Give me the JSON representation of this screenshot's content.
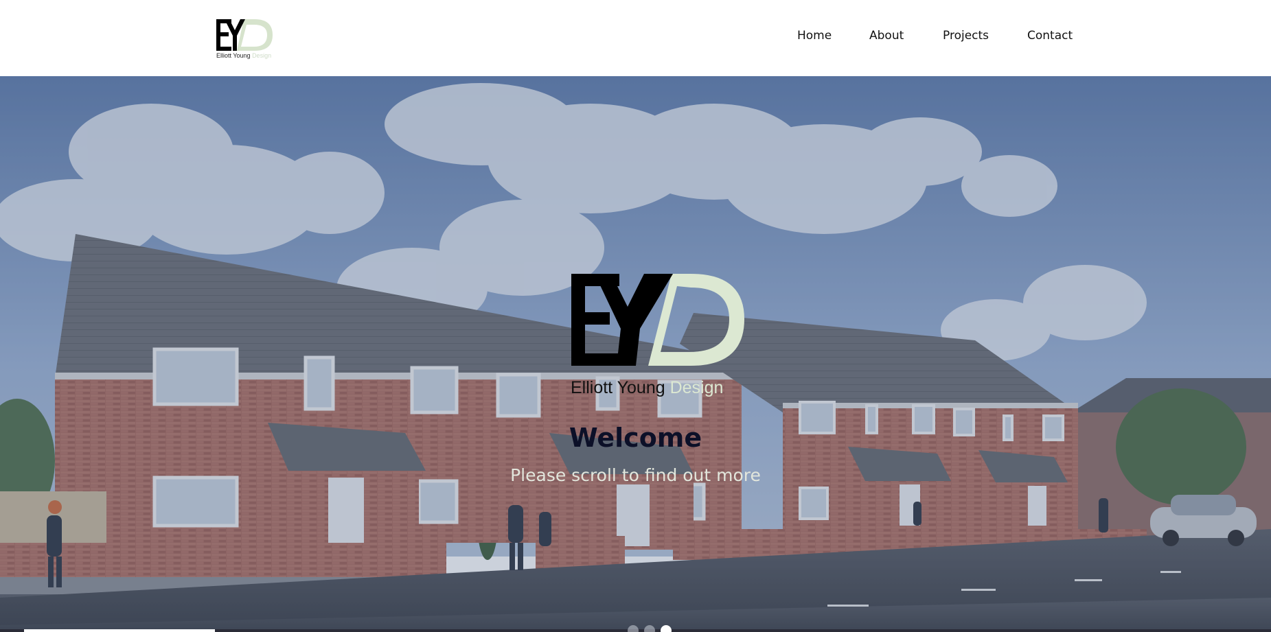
{
  "brand": {
    "name_primary": "Elliott Young",
    "name_accent": "Design",
    "accent_color": "#d6e3cc"
  },
  "nav": {
    "items": [
      {
        "label": "Home"
      },
      {
        "label": "About"
      },
      {
        "label": "Projects"
      },
      {
        "label": "Contact"
      }
    ]
  },
  "hero": {
    "title": "Welcome",
    "subtitle": "Please scroll to find out more",
    "background_description_icon": "photo-housing-row",
    "overlay_color": "#46587d"
  },
  "slider": {
    "slide_count": 3,
    "active_slide": 3,
    "progress_fraction": 0.15
  }
}
